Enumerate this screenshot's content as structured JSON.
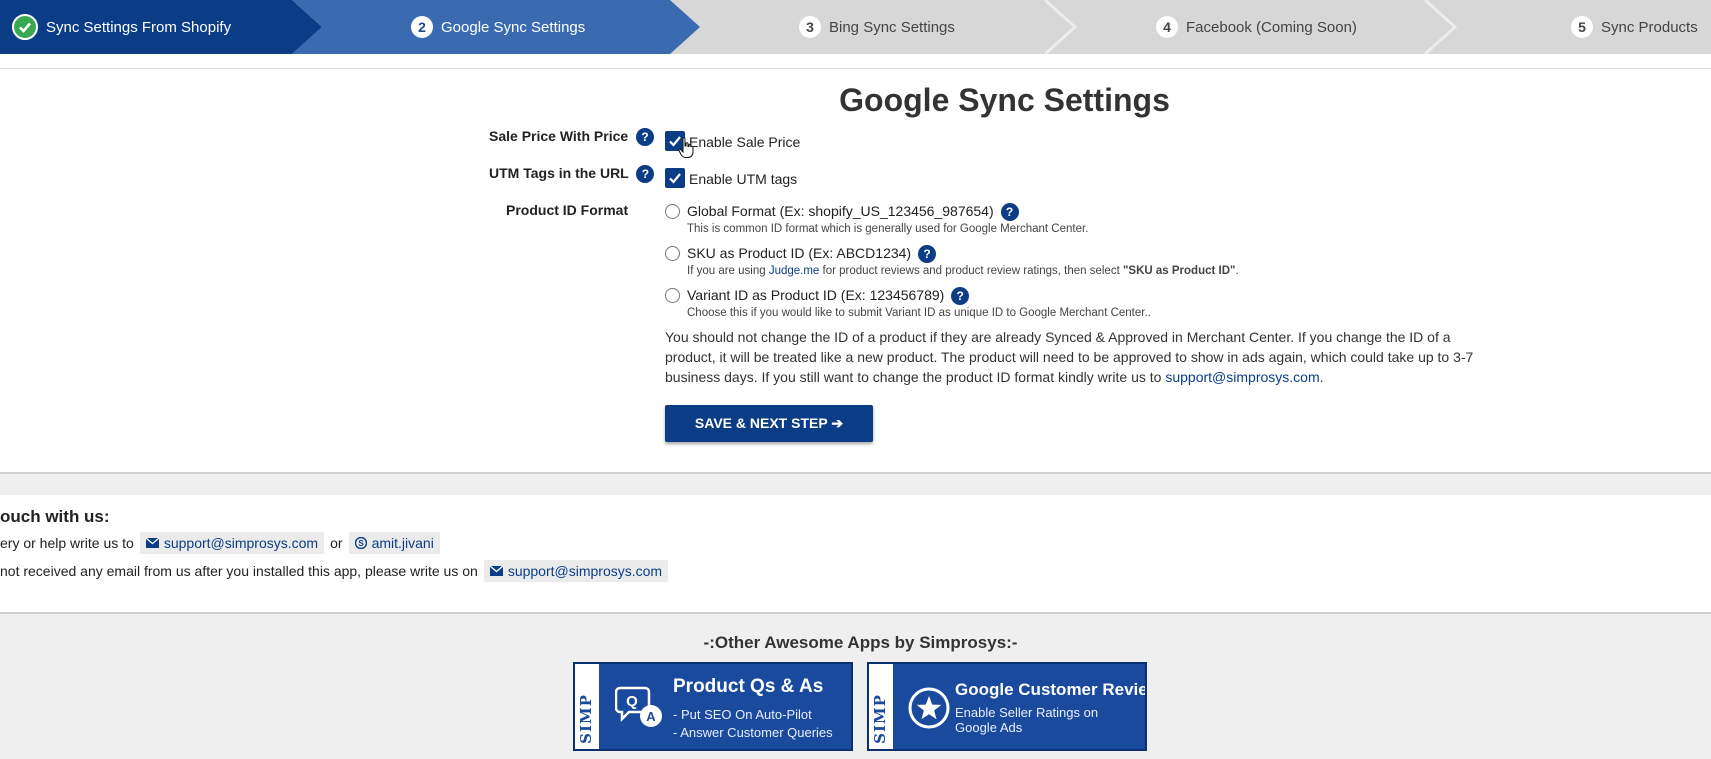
{
  "stepper": {
    "steps": [
      {
        "num": "",
        "label": "Sync Settings From Shopify",
        "state": "done"
      },
      {
        "num": "2",
        "label": "Google Sync Settings",
        "state": "active"
      },
      {
        "num": "3",
        "label": "Bing Sync Settings",
        "state": "todo"
      },
      {
        "num": "4",
        "label": "Facebook (Coming Soon)",
        "state": "todo"
      },
      {
        "num": "5",
        "label": "Sync Products",
        "state": "todo"
      }
    ]
  },
  "form": {
    "title": "Google Sync Settings",
    "sale_price_label": "Sale Price With Price",
    "sale_price_option": "Enable Sale Price",
    "sale_price_checked": true,
    "utm_label": "UTM Tags in the URL",
    "utm_option": "Enable UTM tags",
    "utm_checked": true,
    "product_id_label": "Product ID Format",
    "help_glyph": "?",
    "options": [
      {
        "label": "Global Format (Ex: shopify_US_123456_987654)",
        "hint": "This is common ID format which is generally used for Google Merchant Center."
      },
      {
        "label": "SKU as Product ID (Ex: ABCD1234)",
        "hint_prefix": "If you are using ",
        "hint_link": "Judge.me",
        "hint_mid": " for product reviews and product review ratings, then select ",
        "hint_bold": "\"SKU as Product ID\"",
        "hint_suffix": "."
      },
      {
        "label": "Variant ID as Product ID (Ex: 123456789)",
        "hint": "Choose this if you would like to submit Variant ID as unique ID to Google Merchant Center.."
      }
    ],
    "warning_text": "You should not change the ID of a product if they are already Synced & Approved in Merchant Center. If you change the ID of a product, it will be treated like a new product. The product will need to be approved to show in ads again, which could take up to 3-7 business days. If you still want to change the product ID format kindly write us to ",
    "warning_email": "support@simprosys.com",
    "warning_end": ".",
    "save_button": "SAVE & NEXT STEP ➔"
  },
  "contact": {
    "title": "ouch with us:",
    "line1_prefix": "ery or help write us to",
    "line1_email": "support@simprosys.com",
    "line1_or": "or",
    "line1_skype": "amit.jivani",
    "line2_prefix": "not received any email from us after you installed this app, please write us on",
    "line2_email": "support@simprosys.com"
  },
  "apps": {
    "title": "-:Other Awesome Apps by Simprosys:-",
    "brand": "SIMP",
    "cards": [
      {
        "name": "Product Qs & As",
        "sub1": "- Put SEO On Auto-Pilot",
        "sub2": "- Answer Customer Queries",
        "icon": "qa-chat-icon"
      },
      {
        "name": "Google Customer Reviews",
        "sub1": "Enable Seller Ratings on",
        "sub2": "Google Ads",
        "icon": "star-badge-icon"
      }
    ]
  },
  "colors": {
    "brand_blue": "#0b3d86",
    "active_step": "#3a6bb0",
    "done_step": "#0b3d86",
    "todo_step": "#d7d7d7",
    "check_green": "#3aa852"
  }
}
